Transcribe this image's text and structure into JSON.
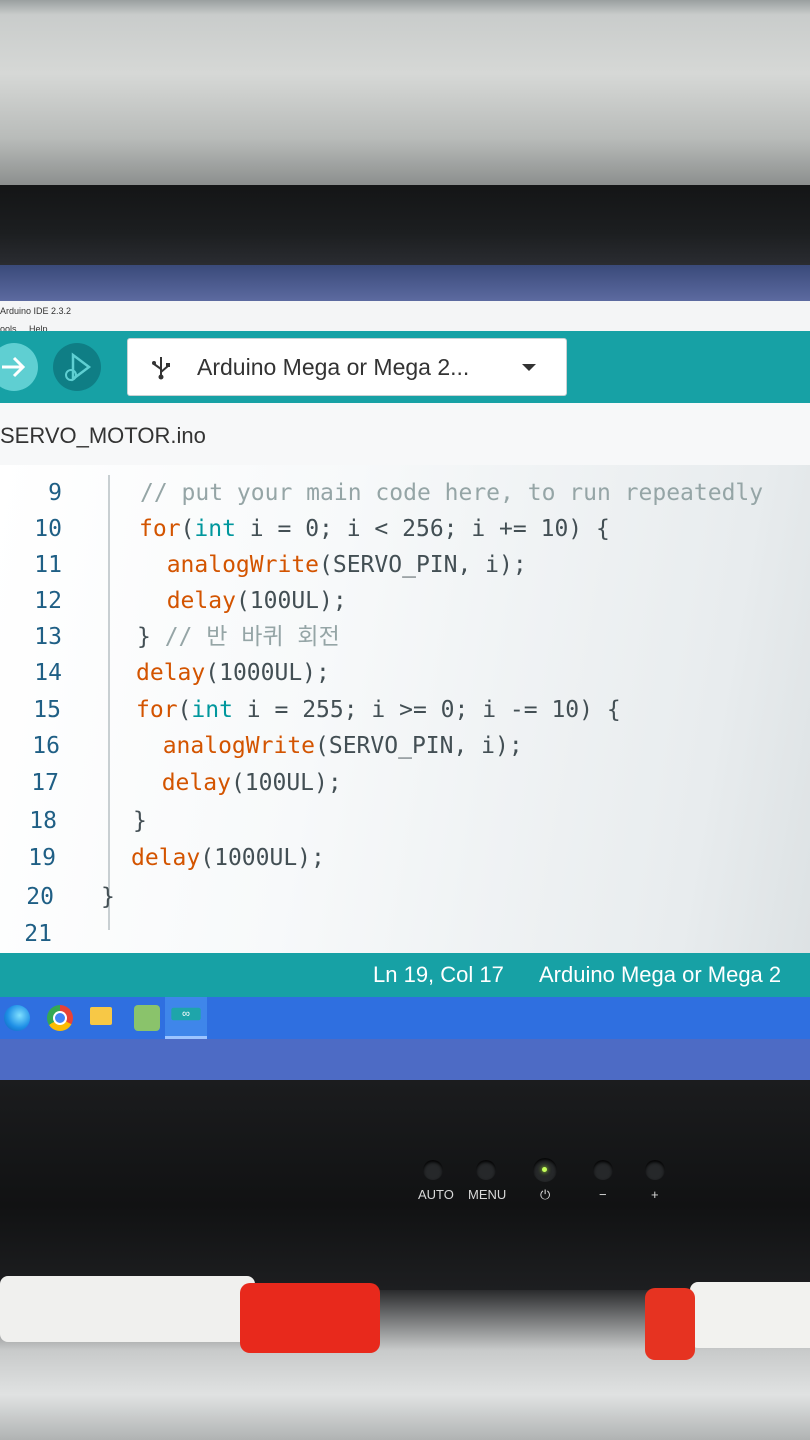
{
  "window": {
    "title": "Arduino IDE 2.3.2",
    "menu": [
      "ools",
      "Help"
    ]
  },
  "toolbar": {
    "board": "Arduino Mega or Mega 2..."
  },
  "tab": {
    "file_name": "SERVO_MOTOR.ino"
  },
  "editor": {
    "lines": [
      {
        "num": "9",
        "parts": [
          {
            "t": "// put your main code here, to run repeatedly",
            "c": "cm"
          }
        ]
      },
      {
        "num": "10",
        "parts": [
          {
            "t": "for",
            "c": "fn"
          },
          {
            "t": "(",
            "c": ""
          },
          {
            "t": "int",
            "c": "kw"
          },
          {
            "t": " i = 0; i < 256; i += 10) {",
            "c": ""
          }
        ]
      },
      {
        "num": "11",
        "parts": [
          {
            "t": "  analogWrite",
            "c": "fn"
          },
          {
            "t": "(SERVO_PIN, i);",
            "c": ""
          }
        ]
      },
      {
        "num": "12",
        "parts": [
          {
            "t": "  delay",
            "c": "fn"
          },
          {
            "t": "(100UL);",
            "c": ""
          }
        ]
      },
      {
        "num": "13",
        "parts": [
          {
            "t": "} ",
            "c": ""
          },
          {
            "t": "// 반 바퀴 회전",
            "c": "cm"
          }
        ]
      },
      {
        "num": "14",
        "parts": [
          {
            "t": "delay",
            "c": "fn"
          },
          {
            "t": "(1000UL);",
            "c": ""
          }
        ]
      },
      {
        "num": "15",
        "parts": [
          {
            "t": "for",
            "c": "fn"
          },
          {
            "t": "(",
            "c": ""
          },
          {
            "t": "int",
            "c": "kw"
          },
          {
            "t": " i = 255; i >= 0; i -= 10) {",
            "c": ""
          }
        ]
      },
      {
        "num": "16",
        "parts": [
          {
            "t": "  analogWrite",
            "c": "fn"
          },
          {
            "t": "(SERVO_PIN, i);",
            "c": ""
          }
        ]
      },
      {
        "num": "17",
        "parts": [
          {
            "t": "  delay",
            "c": "fn"
          },
          {
            "t": "(100UL);",
            "c": ""
          }
        ]
      },
      {
        "num": "18",
        "parts": [
          {
            "t": "}",
            "c": ""
          }
        ]
      },
      {
        "num": "19",
        "parts": [
          {
            "t": "delay",
            "c": "fn"
          },
          {
            "t": "(1000UL);",
            "c": ""
          }
        ]
      },
      {
        "num": "20",
        "parts": [
          {
            "t": "}",
            "c": ""
          }
        ]
      },
      {
        "num": "21",
        "parts": []
      }
    ]
  },
  "statusbar": {
    "cursor": "Ln 19, Col 17",
    "board": "Arduino Mega or Mega 2"
  },
  "monitor": {
    "buttons": [
      "AUTO",
      "MENU",
      "⏻",
      "−",
      "+"
    ]
  },
  "colors": {
    "accent": "#17a1a5",
    "keyword": "#00979d",
    "function": "#d35400",
    "comment": "#95a5a6",
    "line_number": "#1f5f85"
  }
}
